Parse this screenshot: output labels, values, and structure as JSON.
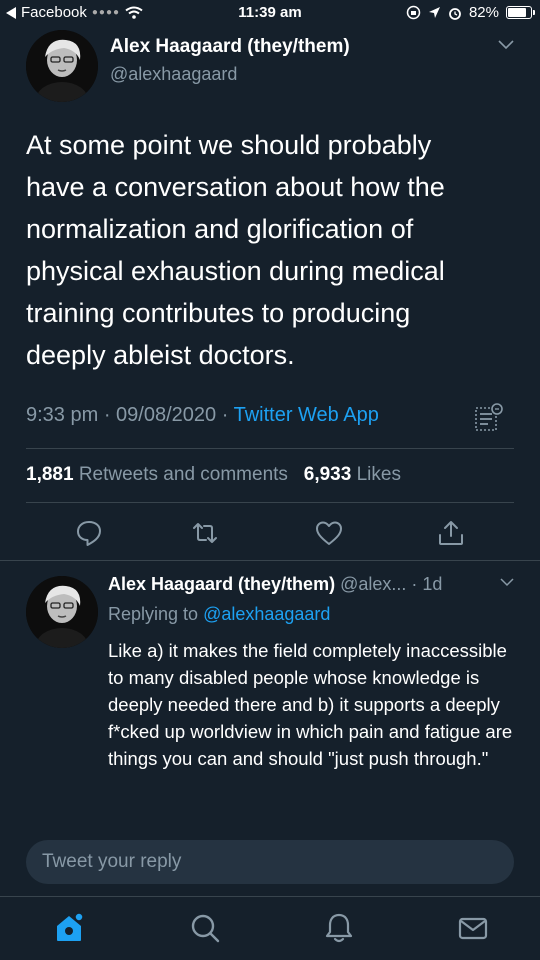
{
  "status_bar": {
    "back_app": "Facebook",
    "time": "11:39 am",
    "battery": "82%",
    "battery_level": 0.82
  },
  "tweet": {
    "author_name": "Alex Haagaard (they/them)",
    "author_handle": "@alexhaagaard",
    "text": "At some point we should probably have a conversation about how the normalization and glorification of physical exhaustion during medical training contributes to producing deeply ableist doctors.",
    "time": "9:33 pm",
    "date": "09/08/2020",
    "source": "Twitter Web App",
    "retweets_count": "1,881",
    "retweets_label": "Retweets and comments",
    "likes_count": "6,933",
    "likes_label": "Likes"
  },
  "reply": {
    "author_name": "Alex Haagaard (they/them)",
    "author_handle_truncated": "@alex...",
    "age": "1d",
    "replying_label": "Replying to",
    "replying_to": "@alexhaagaard",
    "text": "Like a) it makes the field completely inaccessible to many disabled people whose knowledge is deeply needed there and b) it supports a deeply f*cked up worldview in which pain and fatigue are things you can and should \"just push through.\""
  },
  "compose": {
    "placeholder": "Tweet your reply"
  },
  "icons": {
    "actions": [
      "reply-icon",
      "retweet-icon",
      "like-icon",
      "share-icon"
    ],
    "tabs": [
      "home-icon",
      "search-icon",
      "notifications-icon",
      "messages-icon"
    ]
  },
  "colors": {
    "background": "#15202b",
    "accent": "#1da1f2",
    "secondary_text": "#8899a6",
    "divider": "#38444d"
  }
}
